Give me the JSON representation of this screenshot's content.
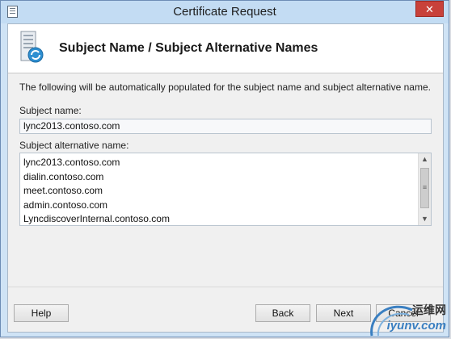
{
  "window": {
    "title": "Certificate Request"
  },
  "header": {
    "title": "Subject Name / Subject Alternative Names",
    "icon": "certificate-server-icon"
  },
  "description": "The following will be automatically populated for the subject name and subject alternative name.",
  "subject_name": {
    "label": "Subject name:",
    "value": "lync2013.contoso.com"
  },
  "subject_alt_names": {
    "label": "Subject alternative name:",
    "items": [
      "lync2013.contoso.com",
      "dialin.contoso.com",
      "meet.contoso.com",
      "admin.contoso.com",
      "LyncdiscoverInternal.contoso.com"
    ]
  },
  "buttons": {
    "help": "Help",
    "back": "Back",
    "next": "Next",
    "cancel": "Cancel"
  },
  "watermark": {
    "top": "运维网",
    "bottom": "iyunv.com"
  },
  "colors": {
    "titlebar": "#c3dcf3",
    "close": "#c8413a",
    "header_bg": "#ffffff",
    "client_bg": "#f0f0f0"
  }
}
